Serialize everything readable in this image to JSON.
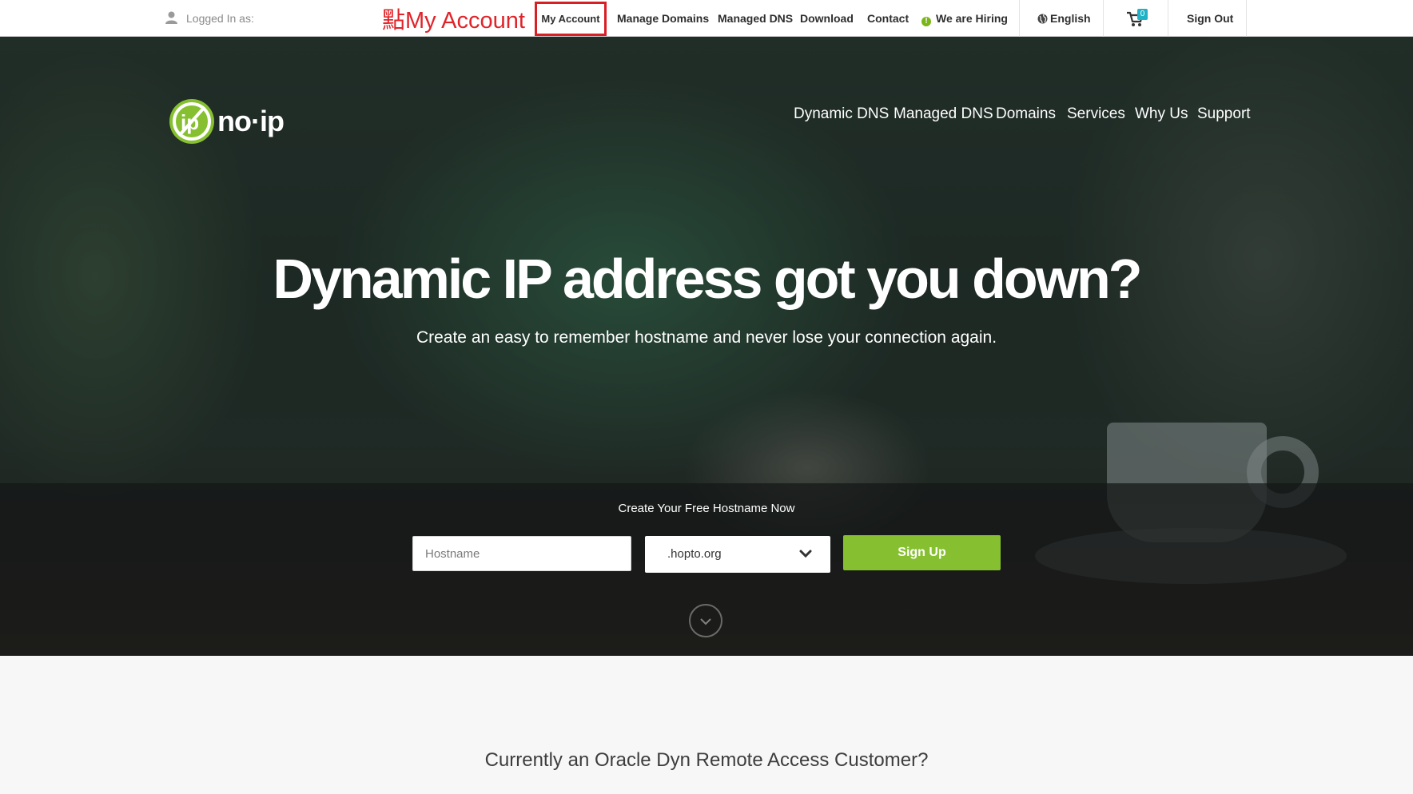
{
  "topbar": {
    "logged_in_label": "Logged In as:",
    "annotation": "點My Account",
    "items": [
      {
        "label": "My Account"
      },
      {
        "label": "Manage Domains"
      },
      {
        "label": "Managed DNS"
      },
      {
        "label": "Download"
      },
      {
        "label": "Contact"
      },
      {
        "label": "We are Hiring"
      }
    ],
    "language": "English",
    "cart_count": "0",
    "sign_out": "Sign Out"
  },
  "brand": {
    "name": "no-ip",
    "accent": "#86c030"
  },
  "mainnav": {
    "items": [
      {
        "label": "Dynamic DNS"
      },
      {
        "label": "Managed DNS"
      },
      {
        "label": "Domains"
      },
      {
        "label": "Services"
      },
      {
        "label": "Why Us"
      },
      {
        "label": "Support"
      }
    ]
  },
  "hero": {
    "headline": "Dynamic IP address got you down?",
    "subline": "Create an easy to remember hostname and never lose your connection again."
  },
  "signup": {
    "title": "Create Your Free Hostname Now",
    "hostname_placeholder": "Hostname",
    "domain_selected": ".hopto.org",
    "button": "Sign Up"
  },
  "section": {
    "oracle_heading": "Currently an Oracle Dyn Remote Access Customer?"
  }
}
